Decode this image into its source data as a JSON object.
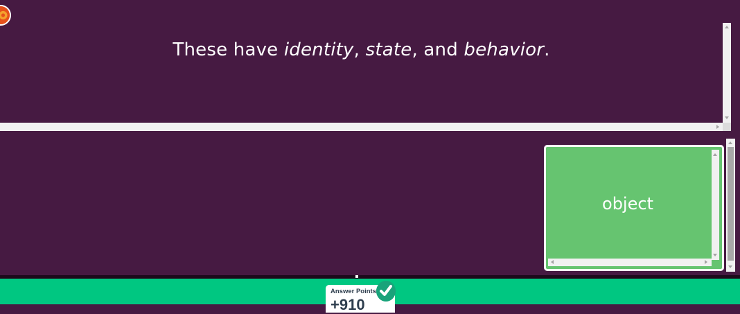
{
  "question": {
    "prefix": "These have ",
    "term1": "identity",
    "sep1": ", ",
    "term2": "state",
    "sep2": ", and ",
    "term3": "behavior",
    "suffix": "."
  },
  "answer": {
    "label": "object",
    "status": "correct"
  },
  "footer": {
    "points_label": "Answer Points",
    "points_value": "+910"
  },
  "colors": {
    "background": "#461a42",
    "answer_correct": "#66c470",
    "footer": "#00c781",
    "check_badge": "#19a37a"
  },
  "icons": {
    "avatar": "player-avatar-icon",
    "check": "checkmark-icon"
  }
}
